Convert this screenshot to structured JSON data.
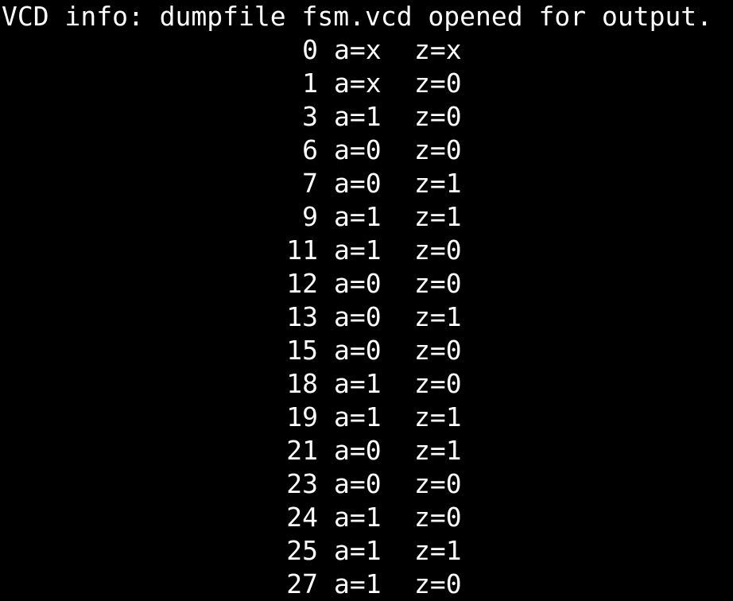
{
  "terminal": {
    "header": "VCD info: dumpfile fsm.vcd opened for output.",
    "rows": [
      {
        "time": "0",
        "a": "a=x",
        "z": "z=x"
      },
      {
        "time": "1",
        "a": "a=x",
        "z": "z=0"
      },
      {
        "time": "3",
        "a": "a=1",
        "z": "z=0"
      },
      {
        "time": "6",
        "a": "a=0",
        "z": "z=0"
      },
      {
        "time": "7",
        "a": "a=0",
        "z": "z=1"
      },
      {
        "time": "9",
        "a": "a=1",
        "z": "z=1"
      },
      {
        "time": "11",
        "a": "a=1",
        "z": "z=0"
      },
      {
        "time": "12",
        "a": "a=0",
        "z": "z=0"
      },
      {
        "time": "13",
        "a": "a=0",
        "z": "z=1"
      },
      {
        "time": "15",
        "a": "a=0",
        "z": "z=0"
      },
      {
        "time": "18",
        "a": "a=1",
        "z": "z=0"
      },
      {
        "time": "19",
        "a": "a=1",
        "z": "z=1"
      },
      {
        "time": "21",
        "a": "a=0",
        "z": "z=1"
      },
      {
        "time": "23",
        "a": "a=0",
        "z": "z=0"
      },
      {
        "time": "24",
        "a": "a=1",
        "z": "z=0"
      },
      {
        "time": "25",
        "a": "a=1",
        "z": "z=1"
      },
      {
        "time": "27",
        "a": "a=1",
        "z": "z=0"
      }
    ]
  },
  "colors": {
    "background": "#000000",
    "foreground": "#ffffff"
  }
}
